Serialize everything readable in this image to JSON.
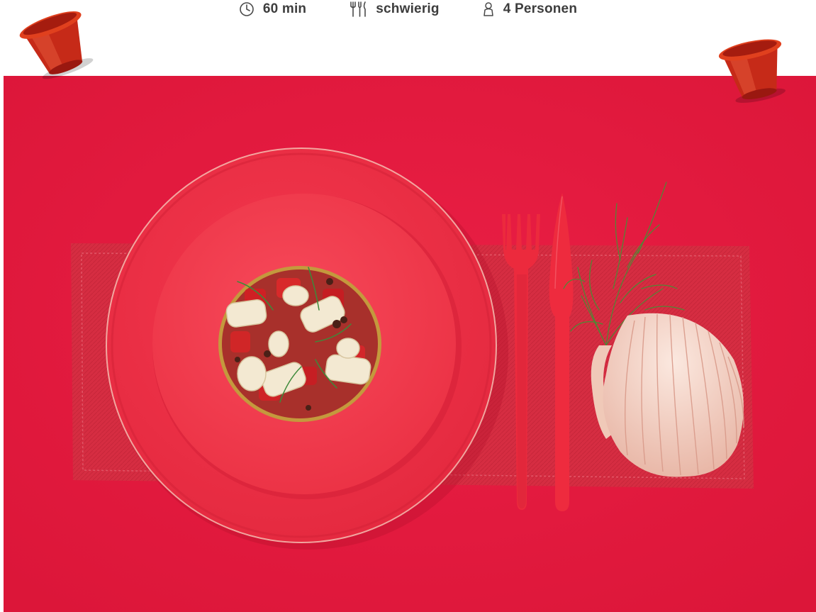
{
  "recipe_meta": {
    "time": {
      "icon": "clock-icon",
      "label": "60 min"
    },
    "difficulty": {
      "icon": "cutlery-icon",
      "label": "schwierig"
    },
    "servings": {
      "icon": "person-icon",
      "label": "4 Personen"
    }
  },
  "hero": {
    "background_color": "#e3183d",
    "subject": "plate-with-dish"
  },
  "decor": {
    "capsule_color": "#c8281a"
  }
}
